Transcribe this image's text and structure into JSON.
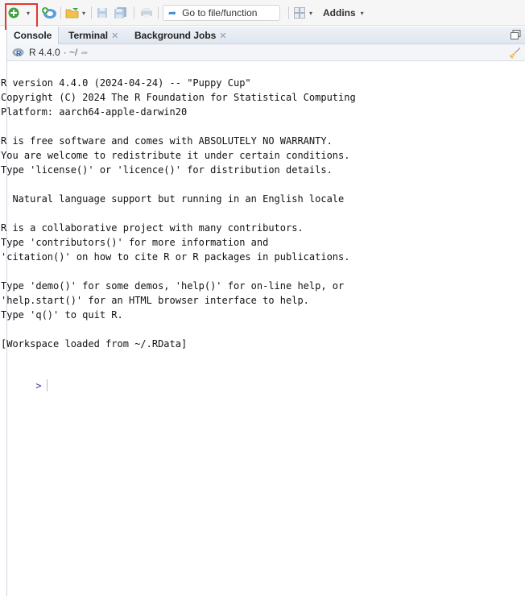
{
  "toolbar": {
    "new_file_icon": "plus-circle-icon",
    "goto_placeholder": "Go to file/function",
    "addins_label": "Addins"
  },
  "console_pane": {
    "tabs": [
      {
        "label": "Console",
        "active": true
      },
      {
        "label": "Terminal",
        "active": false
      },
      {
        "label": "Background Jobs",
        "active": false
      }
    ],
    "r_version": "R 4.4.0",
    "working_dir": "· ~/",
    "output_lines": [
      "R version 4.4.0 (2024-04-24) -- \"Puppy Cup\"",
      "Copyright (C) 2024 The R Foundation for Statistical Computing",
      "Platform: aarch64-apple-darwin20",
      "",
      "R is free software and comes with ABSOLUTELY NO WARRANTY.",
      "You are welcome to redistribute it under certain conditions.",
      "Type 'license()' or 'licence()' for distribution details.",
      "",
      "  Natural language support but running in an English locale",
      "",
      "R is a collaborative project with many contributors.",
      "Type 'contributors()' for more information and",
      "'citation()' on how to cite R or R packages in publications.",
      "",
      "Type 'demo()' for some demos, 'help()' for on-line help, or",
      "'help.start()' for an HTML browser interface to help.",
      "Type 'q()' to quit R.",
      "",
      "[Workspace loaded from ~/.RData]"
    ],
    "prompt": ">"
  },
  "colors": {
    "highlight_box": "#e0382f",
    "prompt": "#3a3a99",
    "tab_bar": "#e5ebf2"
  }
}
